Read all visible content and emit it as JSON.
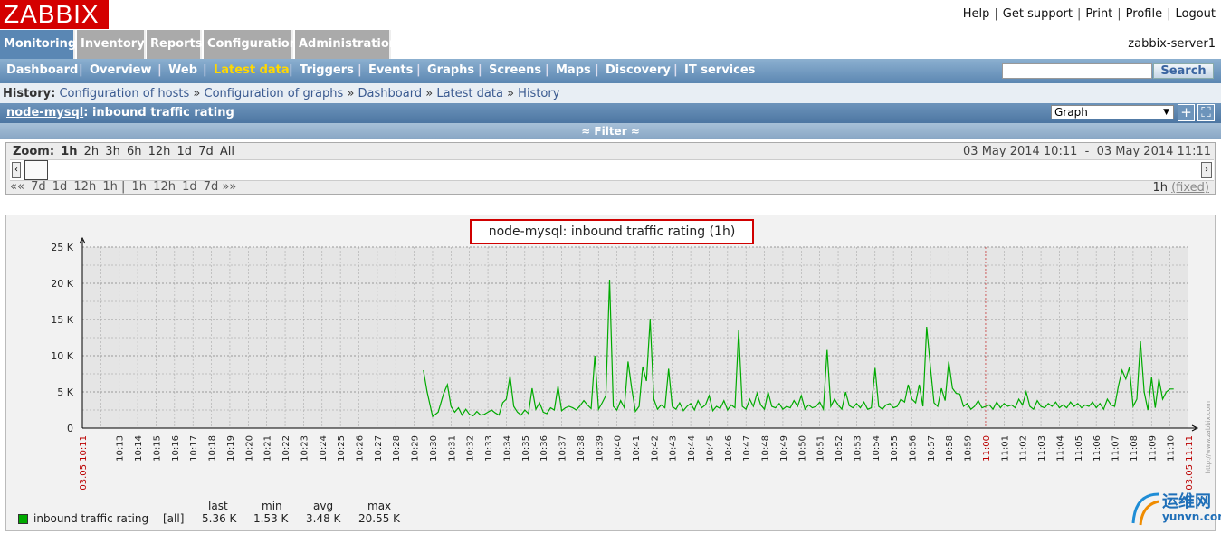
{
  "logo": "ZABBIX",
  "toplinks": [
    "Help",
    "Get support",
    "Print",
    "Profile",
    "Logout"
  ],
  "main_tabs": [
    "Monitoring",
    "Inventory",
    "Reports",
    "Configuration",
    "Administration"
  ],
  "server_name": "zabbix-server1",
  "subnav": [
    "Dashboard",
    "Overview",
    "Web",
    "Latest data",
    "Triggers",
    "Events",
    "Graphs",
    "Screens",
    "Maps",
    "Discovery",
    "IT services"
  ],
  "search": {
    "button": "Search",
    "placeholder": ""
  },
  "history": {
    "label": "History:",
    "items": [
      "Configuration of hosts",
      "Configuration of graphs",
      "Dashboard",
      "Latest data",
      "History"
    ]
  },
  "page_title": {
    "host": "node-mysql",
    "rest": ": inbound traffic rating"
  },
  "view_select": "Graph",
  "filter_label": "Filter",
  "zoom": {
    "label": "Zoom:",
    "current": "1h",
    "options": [
      "2h",
      "3h",
      "6h",
      "12h",
      "1d",
      "7d",
      "All"
    ],
    "date_from": "03 May 2014 10:11",
    "date_sep": "-",
    "date_to": "03 May 2014 11:11",
    "back_links": [
      "7d",
      "1d",
      "12h",
      "1h"
    ],
    "fwd_links": [
      "1h",
      "12h",
      "1d",
      "7d"
    ],
    "back_sym": "««",
    "fwd_sym": "»»",
    "divider": "|",
    "period": "1h",
    "fixed": "(fixed)"
  },
  "legend": {
    "headers": [
      "last",
      "min",
      "avg",
      "max"
    ],
    "item": "inbound traffic rating",
    "func": "[all]",
    "values": [
      "5.36 K",
      "1.53 K",
      "3.48 K",
      "20.55 K"
    ]
  },
  "watermark": {
    "text": "运维网",
    "url": "yunvn.com",
    "side": "http://www.zabbix.com"
  },
  "colors": {
    "series": "#00aa00",
    "accent": "#d40000",
    "nav_active": "#ffd800"
  },
  "chart_data": {
    "type": "line",
    "title": "node-mysql: inbound traffic rating (1h)",
    "ylabel": "",
    "ylim": [
      0,
      25000
    ],
    "yticks": [
      "0",
      "5 K",
      "10 K",
      "15 K",
      "20 K",
      "25 K"
    ],
    "xticks": [
      "10:13",
      "10:14",
      "10:15",
      "10:16",
      "10:17",
      "10:18",
      "10:19",
      "10:20",
      "10:21",
      "10:22",
      "10:23",
      "10:24",
      "10:25",
      "10:26",
      "10:27",
      "10:28",
      "10:29",
      "10:30",
      "10:31",
      "10:32",
      "10:33",
      "10:34",
      "10:35",
      "10:36",
      "10:37",
      "10:38",
      "10:39",
      "10:40",
      "10:41",
      "10:42",
      "10:43",
      "10:44",
      "10:45",
      "10:46",
      "10:47",
      "10:48",
      "10:49",
      "10:50",
      "10:51",
      "10:52",
      "10:53",
      "10:54",
      "10:55",
      "10:56",
      "10:57",
      "10:58",
      "10:59",
      "11:00",
      "11:01",
      "11:02",
      "11:03",
      "11:04",
      "11:05",
      "11:06",
      "11:07",
      "11:08",
      "11:09",
      "11:10"
    ],
    "x_start_label": "03.05 10:11",
    "x_end_label": "03.05 11:11",
    "series": [
      {
        "name": "inbound traffic rating",
        "color": "#00aa00",
        "x_minutes": [
          18.5,
          18.7,
          19.0,
          19.3,
          19.6,
          19.8,
          20.0,
          20.2,
          20.4,
          20.6,
          20.8,
          21.0,
          21.2,
          21.4,
          21.6,
          21.8,
          22.0,
          22.2,
          22.4,
          22.6,
          22.8,
          23.0,
          23.2,
          23.4,
          23.6,
          23.8,
          24.0,
          24.2,
          24.4,
          24.6,
          24.8,
          25.0,
          25.2,
          25.4,
          25.6,
          25.8,
          26.0,
          26.2,
          26.4,
          26.6,
          26.8,
          27.0,
          27.2,
          27.4,
          27.6,
          27.8,
          28.0,
          28.2,
          28.4,
          28.6,
          28.8,
          29.0,
          29.2,
          29.4,
          29.6,
          29.8,
          30.0,
          30.2,
          30.4,
          30.6,
          30.8,
          31.0,
          31.2,
          31.4,
          31.6,
          31.8,
          32.0,
          32.2,
          32.4,
          32.6,
          32.8,
          33.0,
          33.2,
          33.4,
          33.6,
          33.8,
          34.0,
          34.2,
          34.4,
          34.6,
          34.8,
          35.0,
          35.2,
          35.4,
          35.6,
          35.8,
          36.0,
          36.2,
          36.4,
          36.6,
          36.8,
          37.0,
          37.2,
          37.4,
          37.6,
          37.8,
          38.0,
          38.2,
          38.4,
          38.6,
          38.8,
          39.0,
          39.2,
          39.4,
          39.6,
          39.8,
          40.0,
          40.2,
          40.4,
          40.6,
          40.8,
          41.0,
          41.2,
          41.4,
          41.6,
          41.8,
          42.0,
          42.2,
          42.4,
          42.6,
          42.8,
          43.0,
          43.2,
          43.4,
          43.6,
          43.8,
          44.0,
          44.2,
          44.4,
          44.6,
          44.8,
          45.0,
          45.2,
          45.4,
          45.6,
          45.8,
          46.0,
          46.2,
          46.4,
          46.6,
          46.8,
          47.0,
          47.2,
          47.4,
          47.6,
          47.8,
          48.0,
          48.2,
          48.4,
          48.6,
          48.8,
          49.0,
          49.2,
          49.4,
          49.6,
          49.8,
          50.0,
          50.2,
          50.4,
          50.6,
          50.8,
          51.0,
          51.2,
          51.4,
          51.6,
          51.8,
          52.0,
          52.2,
          52.4,
          52.6,
          52.8,
          53.0,
          53.2,
          53.4,
          53.6,
          53.8,
          54.0,
          54.2,
          54.4,
          54.6,
          54.8,
          55.0,
          55.2,
          55.4,
          55.6,
          55.8,
          56.0,
          56.2,
          56.4,
          56.6,
          56.8,
          57.0,
          57.2,
          57.4,
          57.6,
          57.8,
          58.0,
          58.2,
          58.4,
          58.6,
          58.8,
          59.0,
          59.2,
          59.4,
          59.6,
          59.8,
          60.0
        ],
        "values": [
          8000,
          5000,
          1600,
          2200,
          4800,
          6000,
          3000,
          2200,
          2800,
          1800,
          2600,
          1900,
          1700,
          2300,
          1800,
          1900,
          2200,
          2500,
          2100,
          1800,
          3500,
          4000,
          7200,
          3000,
          2200,
          1800,
          2500,
          2000,
          5500,
          2600,
          3500,
          2200,
          2000,
          2800,
          2500,
          5800,
          2400,
          2800,
          3000,
          2800,
          2500,
          3100,
          3800,
          3200,
          2700,
          10000,
          2600,
          3500,
          4500,
          20500,
          3000,
          2500,
          3800,
          2800,
          9200,
          5500,
          2300,
          3000,
          8500,
          6500,
          15000,
          4000,
          2600,
          3200,
          2800,
          8200,
          3000,
          2600,
          3500,
          2400,
          3000,
          3400,
          2500,
          3800,
          2800,
          3200,
          4500,
          2400,
          3000,
          2700,
          3800,
          2500,
          3200,
          2800,
          13500,
          3000,
          2600,
          4000,
          3000,
          4800,
          3200,
          2600,
          5000,
          3000,
          2800,
          3400,
          2600,
          3000,
          2800,
          3800,
          3000,
          4500,
          2600,
          3200,
          2800,
          3000,
          3600,
          2600,
          10800,
          3000,
          4000,
          3200,
          2600,
          5000,
          3100,
          2800,
          3400,
          2800,
          3600,
          2600,
          2800,
          8300,
          3000,
          2600,
          3200,
          3400,
          2800,
          3000,
          4000,
          3600,
          6000,
          4000,
          3500,
          6000,
          3000,
          14000,
          8500,
          3500,
          3000,
          5500,
          3800,
          9200,
          5500,
          4800,
          4700,
          3000,
          3400,
          2600,
          3000,
          3800,
          2800,
          3000,
          3200,
          2600,
          3600,
          2800,
          3400,
          3000,
          3200,
          2800,
          4000,
          3200,
          5000,
          3000,
          2600,
          3800,
          3000,
          2800,
          3400,
          3000,
          3600,
          2800,
          3200,
          2800,
          3600,
          3000,
          3400,
          2800,
          3200,
          3000,
          3600,
          2800,
          3400,
          2600,
          4000,
          3200,
          3000,
          5800,
          8000,
          6800,
          8400,
          3000,
          4000,
          12000,
          5000,
          2500,
          7000,
          2800,
          6800,
          4000,
          5000,
          5400,
          5400
        ]
      }
    ]
  }
}
